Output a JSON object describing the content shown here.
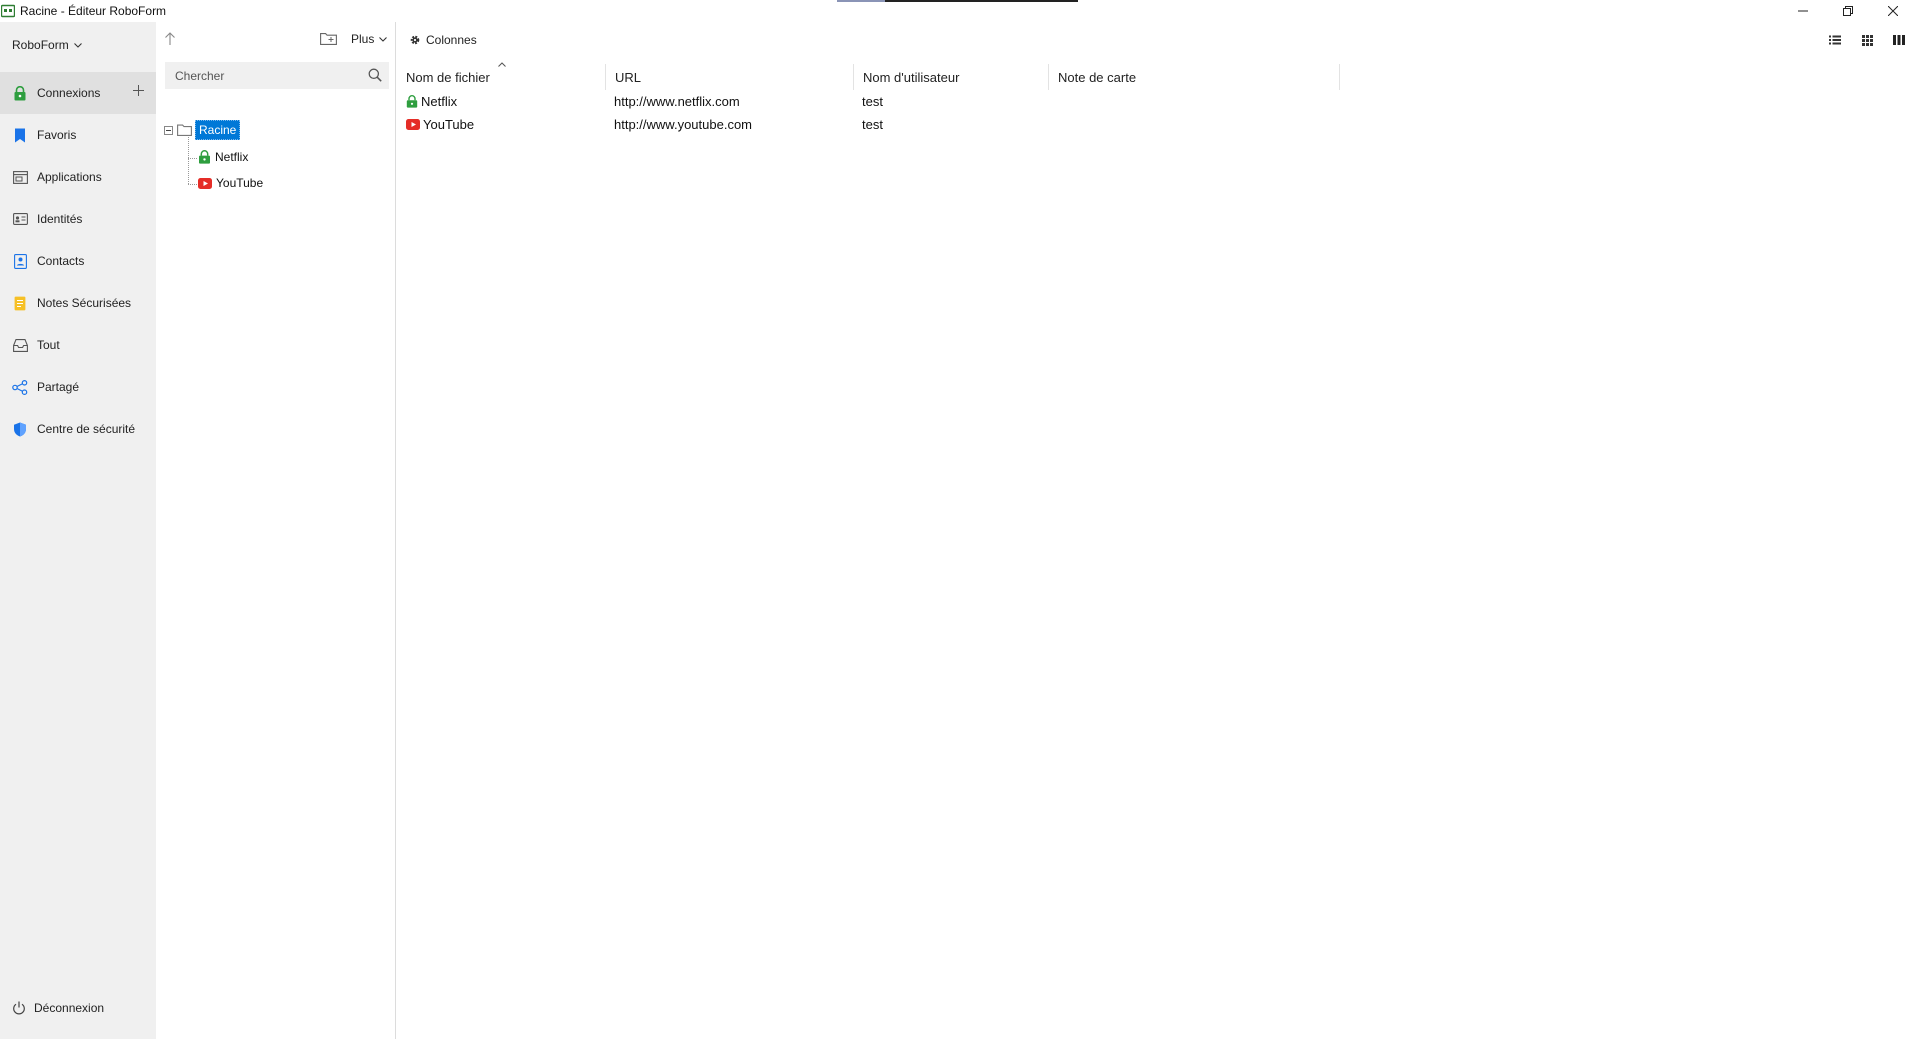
{
  "window": {
    "title": "Racine - Éditeur RoboForm"
  },
  "nav": {
    "brand": "RoboForm",
    "items": [
      {
        "label": "Connexions",
        "icon": "lock-icon"
      },
      {
        "label": "Favoris",
        "icon": "bookmark-icon"
      },
      {
        "label": "Applications",
        "icon": "application-icon"
      },
      {
        "label": "Identités",
        "icon": "identity-card-icon"
      },
      {
        "label": "Contacts",
        "icon": "contact-icon"
      },
      {
        "label": "Notes Sécurisées",
        "icon": "note-icon"
      },
      {
        "label": "Tout",
        "icon": "inbox-icon"
      },
      {
        "label": "Partagé",
        "icon": "share-icon"
      },
      {
        "label": "Centre de sécurité",
        "icon": "shield-icon"
      }
    ],
    "logout_label": "Déconnexion"
  },
  "folder_pane": {
    "more_label": "Plus",
    "search_placeholder": "Chercher",
    "tree": {
      "root_label": "Racine",
      "children": [
        {
          "label": "Netflix",
          "icon": "lock-icon"
        },
        {
          "label": "YouTube",
          "icon": "youtube-icon"
        }
      ]
    }
  },
  "main": {
    "columns_label": "Colonnes",
    "table": {
      "headers": [
        "Nom de fichier",
        "URL",
        "Nom d'utilisateur",
        "Note de carte"
      ],
      "rows": [
        {
          "name": "Netflix",
          "icon": "lock-icon",
          "url": "http://www.netflix.com",
          "user": "test",
          "note": ""
        },
        {
          "name": "YouTube",
          "icon": "youtube-icon",
          "url": "http://www.youtube.com",
          "user": "test",
          "note": ""
        }
      ]
    }
  },
  "colors": {
    "accent_green": "#2e9e3f",
    "accent_blue": "#0078d7",
    "youtube_red": "#e52d27",
    "nav_bg": "#f0f0f0",
    "nav_active_bg": "#e0e0e0"
  }
}
